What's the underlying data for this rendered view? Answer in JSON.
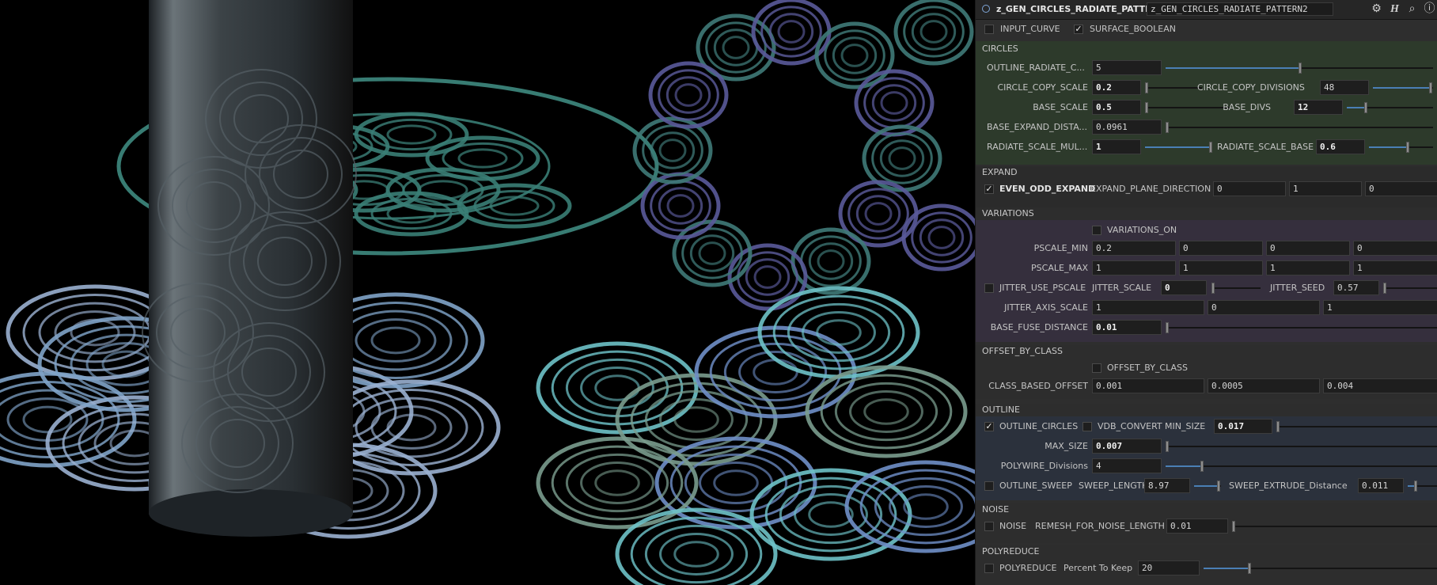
{
  "colors": {
    "panel_bg": "#2e2e2e",
    "circles_bg": "#2d3a2b",
    "variations_bg": "#352f3d",
    "outline_bg": "#2b313c",
    "slider_fill": "#4a7fb5"
  },
  "viewport": {
    "description_icons": [
      "cylinder",
      "concentric-circle-patterns"
    ]
  },
  "header": {
    "node_type": "z_GEN_CIRCLES_RADIATE_PATTERN",
    "node_name": "z_GEN_CIRCLES_RADIATE_PATTERN2",
    "icons": [
      "gear-icon",
      "help-h-icon",
      "search-icon",
      "info-icon"
    ]
  },
  "top": {
    "input_curve": {
      "label": "INPUT_CURVE",
      "checked": false
    },
    "surface_boolean": {
      "label": "SURFACE_BOOLEAN",
      "checked": true
    }
  },
  "circles": {
    "title": "CIRCLES",
    "outline_radiate": {
      "label": "OUTLINE_RADIATE_C...",
      "value": "5",
      "level": 0.5
    },
    "circle_copy_scale": {
      "label": "CIRCLE_COPY_SCALE",
      "value": "0.2",
      "level": 0.0
    },
    "circle_copy_divisions": {
      "label": "CIRCLE_COPY_DIVISIONS",
      "value": "48",
      "level": 0.95
    },
    "base_scale": {
      "label": "BASE_SCALE",
      "value": "0.5",
      "level": 0.0
    },
    "base_divs": {
      "label": "BASE_DIVS",
      "value": "12",
      "level": 0.22
    },
    "base_expand": {
      "label": "BASE_EXPAND_DISTA...",
      "value": "0.0961",
      "level": 0.0
    },
    "radiate_scale_mul": {
      "label": "RADIATE_SCALE_MUL...",
      "value": "1",
      "level": 1.0
    },
    "radiate_scale_base": {
      "label": "RADIATE_SCALE_BASE",
      "value": "0.6",
      "level": 0.6
    }
  },
  "expand": {
    "title": "EXPAND",
    "even_odd": {
      "label": "EVEN_ODD_EXPAND",
      "checked": true
    },
    "plane_dir": {
      "label": "EXPAND_PLANE_DIRECTION",
      "values": [
        "0",
        "1",
        "0"
      ]
    }
  },
  "variations": {
    "title": "VARIATIONS",
    "on": {
      "label": "VARIATIONS_ON",
      "checked": false
    },
    "pscale_min": {
      "label": "PSCALE_MIN",
      "values": [
        "0.2",
        "0",
        "0",
        "0"
      ]
    },
    "pscale_max": {
      "label": "PSCALE_MAX",
      "values": [
        "1",
        "1",
        "1",
        "1"
      ]
    },
    "jitter_use_pscale": {
      "label": "JITTER_USE_PSCALE",
      "checked": false
    },
    "jitter_scale": {
      "label": "JITTER_SCALE",
      "value": "0",
      "level": 0.0
    },
    "jitter_seed": {
      "label": "JITTER_SEED",
      "value": "0.57",
      "level": 0.0
    },
    "jitter_axis": {
      "label": "JITTER_AXIS_SCALE",
      "values": [
        "1",
        "0",
        "1"
      ]
    },
    "base_fuse": {
      "label": "BASE_FUSE_DISTANCE",
      "value": "0.01",
      "level": 0.0
    }
  },
  "offset": {
    "title": "OFFSET_BY_CLASS",
    "toggle": {
      "label": "OFFSET_BY_CLASS",
      "checked": false
    },
    "class_based": {
      "label": "CLASS_BASED_OFFSET",
      "values": [
        "0.001",
        "0.0005",
        "0.004"
      ]
    }
  },
  "outline": {
    "title": "OUTLINE",
    "outline_circles": {
      "label": "OUTLINE_CIRCLES",
      "checked": true
    },
    "vdb_convert": {
      "label": "VDB_CONVERT",
      "checked": false
    },
    "min_size": {
      "label": "MIN_SIZE",
      "value": "0.017",
      "level": 0.0
    },
    "max_size": {
      "label": "MAX_SIZE",
      "value": "0.007",
      "level": 0.0
    },
    "polywire": {
      "label": "POLYWIRE_Divisions",
      "value": "4",
      "level": 0.13
    },
    "outline_sweep": {
      "label": "OUTLINE_SWEEP",
      "checked": false
    },
    "sweep_length": {
      "label": "SWEEP_LENGTH",
      "value": "8.97",
      "level": 0.9
    },
    "sweep_extrude": {
      "label": "SWEEP_EXTRUDE_Distance",
      "value": "0.011",
      "level": 0.2
    }
  },
  "noise": {
    "title": "NOISE",
    "toggle": {
      "label": "NOISE",
      "checked": false
    },
    "remesh": {
      "label": "REMESH_FOR_NOISE_LENGTH",
      "value": "0.01",
      "level": 0.0
    }
  },
  "polyreduce": {
    "title": "POLYREDUCE",
    "toggle": {
      "label": "POLYREDUCE",
      "checked": false
    },
    "percent": {
      "label": "Percent To Keep",
      "value": "20",
      "level": 0.2
    }
  }
}
